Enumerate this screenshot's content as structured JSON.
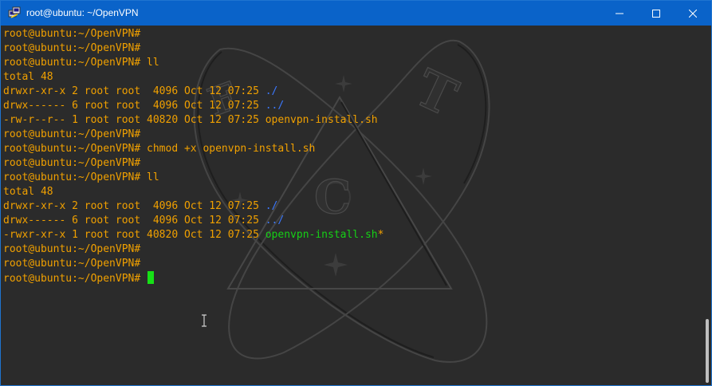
{
  "window": {
    "title": "root@ubuntu: ~/OpenVPN",
    "app_icon": "putty-icon",
    "controls": {
      "minimize": "minimize-icon",
      "maximize": "maximize-icon",
      "close": "close-icon"
    }
  },
  "terminal": {
    "lines": [
      {
        "segments": [
          {
            "text": "root@ubuntu:~/OpenVPN#",
            "style": "normal"
          }
        ]
      },
      {
        "segments": [
          {
            "text": "root@ubuntu:~/OpenVPN#",
            "style": "normal"
          }
        ]
      },
      {
        "segments": [
          {
            "text": "root@ubuntu:~/OpenVPN# ll",
            "style": "normal"
          }
        ]
      },
      {
        "segments": [
          {
            "text": "total 48",
            "style": "normal"
          }
        ]
      },
      {
        "segments": [
          {
            "text": "drwxr-xr-x 2 root root  4096 Oct 12 07:25 ",
            "style": "normal"
          },
          {
            "text": "./",
            "style": "dir"
          }
        ]
      },
      {
        "segments": [
          {
            "text": "drwx------ 6 root root  4096 Oct 12 07:25 ",
            "style": "normal"
          },
          {
            "text": "../",
            "style": "dir"
          }
        ]
      },
      {
        "segments": [
          {
            "text": "-rw-r--r-- 1 root root 40820 Oct 12 07:25 openvpn-install.sh",
            "style": "normal"
          }
        ]
      },
      {
        "segments": [
          {
            "text": "root@ubuntu:~/OpenVPN#",
            "style": "normal"
          }
        ]
      },
      {
        "segments": [
          {
            "text": "root@ubuntu:~/OpenVPN# chmod +x openvpn-install.sh",
            "style": "normal"
          }
        ]
      },
      {
        "segments": [
          {
            "text": "root@ubuntu:~/OpenVPN#",
            "style": "normal"
          }
        ]
      },
      {
        "segments": [
          {
            "text": "root@ubuntu:~/OpenVPN# ll",
            "style": "normal"
          }
        ]
      },
      {
        "segments": [
          {
            "text": "total 48",
            "style": "normal"
          }
        ]
      },
      {
        "segments": [
          {
            "text": "drwxr-xr-x 2 root root  4096 Oct 12 07:25 ",
            "style": "normal"
          },
          {
            "text": "./",
            "style": "dir"
          }
        ]
      },
      {
        "segments": [
          {
            "text": "drwx------ 6 root root  4096 Oct 12 07:25 ",
            "style": "normal"
          },
          {
            "text": "../",
            "style": "dir"
          }
        ]
      },
      {
        "segments": [
          {
            "text": "-rwxr-xr-x 1 root root 40820 Oct 12 07:25 ",
            "style": "normal"
          },
          {
            "text": "openvpn-install.sh",
            "style": "exe"
          },
          {
            "text": "*",
            "style": "normal"
          }
        ]
      },
      {
        "segments": [
          {
            "text": "root@ubuntu:~/OpenVPN#",
            "style": "normal"
          }
        ]
      },
      {
        "segments": [
          {
            "text": "root@ubuntu:~/OpenVPN#",
            "style": "normal"
          }
        ]
      },
      {
        "segments": [
          {
            "text": "root@ubuntu:~/OpenVPN# ",
            "style": "normal"
          }
        ],
        "cursor": true
      }
    ],
    "watermark_letters": [
      "F",
      "T",
      "C"
    ]
  },
  "colors": {
    "titlebar": "#0a63c9",
    "background": "#2b2b2b",
    "text": "#f0a000",
    "dir": "#3b78ff",
    "exe": "#16d016",
    "cursor": "#16e016"
  }
}
